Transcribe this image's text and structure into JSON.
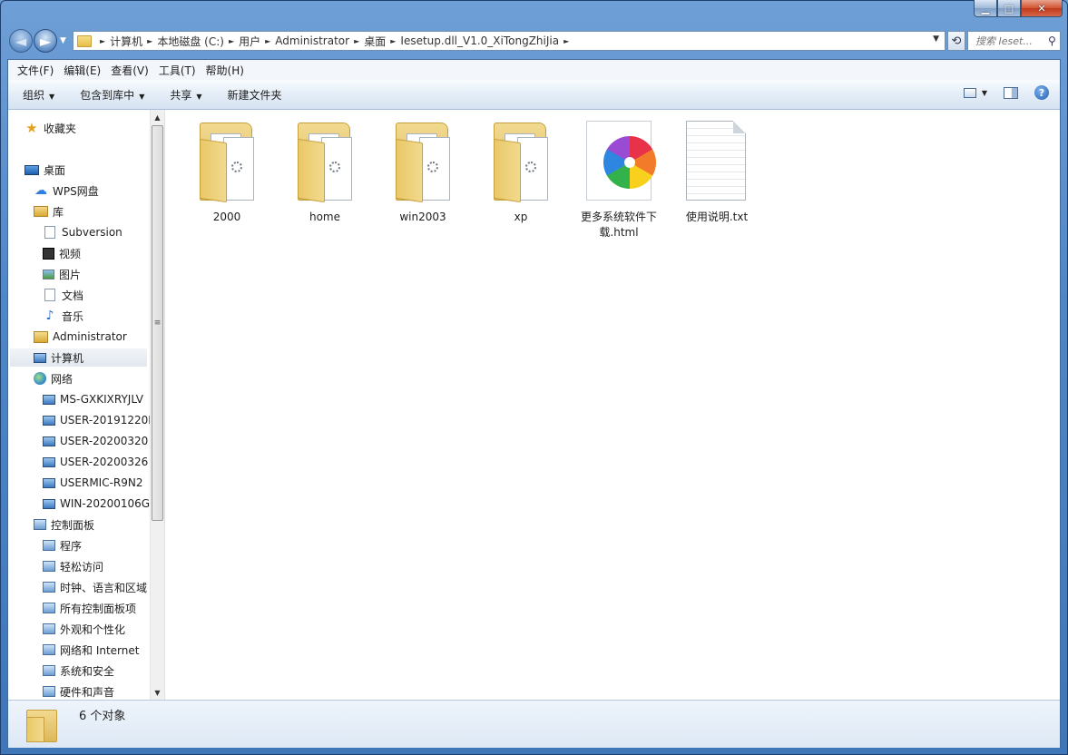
{
  "window": {
    "caption_buttons": [
      "▁",
      "□",
      "✕"
    ]
  },
  "nav": {
    "back_glyph": "◄",
    "forward_glyph": "►",
    "breadcrumbs": [
      "计算机",
      "本地磁盘 (C:)",
      "用户",
      "Administrator",
      "桌面",
      "Iesetup.dll_V1.0_XiTongZhiJia"
    ],
    "search_placeholder": "搜索 Ieset..."
  },
  "menubar": [
    "文件(F)",
    "编辑(E)",
    "查看(V)",
    "工具(T)",
    "帮助(H)"
  ],
  "toolbar": {
    "organize": "组织",
    "include_library": "包含到库中",
    "share": "共享",
    "new_folder": "新建文件夹",
    "help": "?"
  },
  "sidebar": {
    "items": [
      {
        "label": "收藏夹",
        "icon": "star-icon"
      },
      {
        "label": "桌面",
        "icon": "desktop-icon"
      },
      {
        "label": "WPS网盘",
        "icon": "cloud-icon"
      },
      {
        "label": "库",
        "icon": "library-icon"
      },
      {
        "label": "Subversion",
        "icon": "document-icon"
      },
      {
        "label": "视频",
        "icon": "video-icon"
      },
      {
        "label": "图片",
        "icon": "picture-icon"
      },
      {
        "label": "文档",
        "icon": "document-icon"
      },
      {
        "label": "音乐",
        "icon": "music-icon"
      },
      {
        "label": "Administrator",
        "icon": "user-folder-icon"
      },
      {
        "label": "计算机",
        "icon": "computer-icon"
      },
      {
        "label": "网络",
        "icon": "network-icon"
      },
      {
        "label": "MS-GXKIXRYJLV",
        "icon": "computer-icon"
      },
      {
        "label": "USER-20191220I",
        "icon": "computer-icon"
      },
      {
        "label": "USER-20200320",
        "icon": "computer-icon"
      },
      {
        "label": "USER-20200326",
        "icon": "computer-icon"
      },
      {
        "label": "USERMIC-R9N2",
        "icon": "computer-icon"
      },
      {
        "label": "WIN-20200106G",
        "icon": "computer-icon"
      },
      {
        "label": "控制面板",
        "icon": "control-panel-icon"
      },
      {
        "label": "程序",
        "icon": "control-panel-icon"
      },
      {
        "label": "轻松访问",
        "icon": "control-panel-icon"
      },
      {
        "label": "时钟、语言和区域",
        "icon": "control-panel-icon"
      },
      {
        "label": "所有控制面板项",
        "icon": "control-panel-icon"
      },
      {
        "label": "外观和个性化",
        "icon": "control-panel-icon"
      },
      {
        "label": "网络和 Internet",
        "icon": "control-panel-icon"
      },
      {
        "label": "系统和安全",
        "icon": "control-panel-icon"
      },
      {
        "label": "硬件和声音",
        "icon": "control-panel-icon"
      }
    ]
  },
  "files": [
    {
      "name": "2000",
      "type": "folder"
    },
    {
      "name": "home",
      "type": "folder"
    },
    {
      "name": "win2003",
      "type": "folder"
    },
    {
      "name": "xp",
      "type": "folder"
    },
    {
      "name": "更多系统软件下载.html",
      "type": "html"
    },
    {
      "name": "使用说明.txt",
      "type": "txt"
    }
  ],
  "details": {
    "count_text": "6 个对象"
  }
}
